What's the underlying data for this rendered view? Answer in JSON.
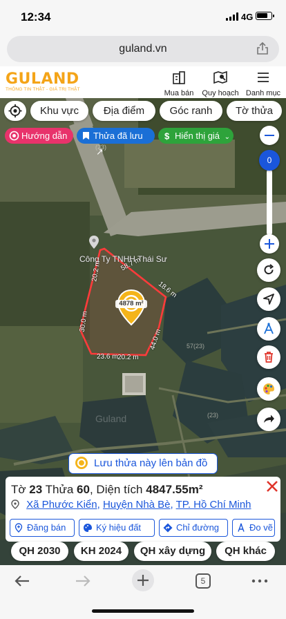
{
  "status_bar": {
    "time": "12:34",
    "network": "4G"
  },
  "browser": {
    "url": "guland.vn",
    "tabs_count": "5"
  },
  "header": {
    "logo": "GULAND",
    "tagline": "THÔNG TIN THẬT - GIÁ TRỊ THẬT",
    "nav": [
      {
        "label": "Mua bán",
        "icon": "building-icon"
      },
      {
        "label": "Quy hoạch",
        "icon": "map-search-icon"
      },
      {
        "label": "Danh mục",
        "icon": "menu-icon"
      }
    ]
  },
  "filters": [
    "Khu vực",
    "Địa điểm",
    "Góc ranh",
    "Tờ thửa"
  ],
  "pills": [
    {
      "label": "Hướng dẫn",
      "color": "#e8336b"
    },
    {
      "label": "Thửa đã lưu",
      "color": "#1a6fd6"
    },
    {
      "label": "Hiển thị giá",
      "color": "#2ea33b"
    }
  ],
  "zoom": {
    "value": "0"
  },
  "map": {
    "company_label": "Công Ty TNHH Thái Sư",
    "area_badge": "4878 m²",
    "edges": [
      "58.7 m",
      "18.6 m",
      "44.0 m",
      "20.2 m",
      "23.6 m",
      "30.0 m",
      "20.2 m"
    ],
    "faint_labels": [
      "(23)",
      "57(23)",
      "(23)"
    ],
    "watermark": "Guland"
  },
  "save_button": "Lưu thửa này lên bản đồ",
  "parcel": {
    "sheet_label": "Tờ",
    "sheet": "23",
    "plot_label": "Thửa",
    "plot": "60",
    "area_label": "Diện tích",
    "area": "4847.55m²",
    "commune": "Xã Phước Kiển",
    "district": "Huyện Nhà Bè",
    "city": "TP. Hồ Chí Minh"
  },
  "actions": [
    "Đăng bán",
    "Ký hiệu đất",
    "Chỉ đường",
    "Đo vẽ"
  ],
  "planning_tabs": [
    "QH 2030",
    "KH 2024",
    "QH xây dựng",
    "QH khác"
  ],
  "colors": {
    "accent": "#1a56db",
    "brand": "#f4a418",
    "parcel_border": "#ff3b3b",
    "close": "#e0352b"
  }
}
